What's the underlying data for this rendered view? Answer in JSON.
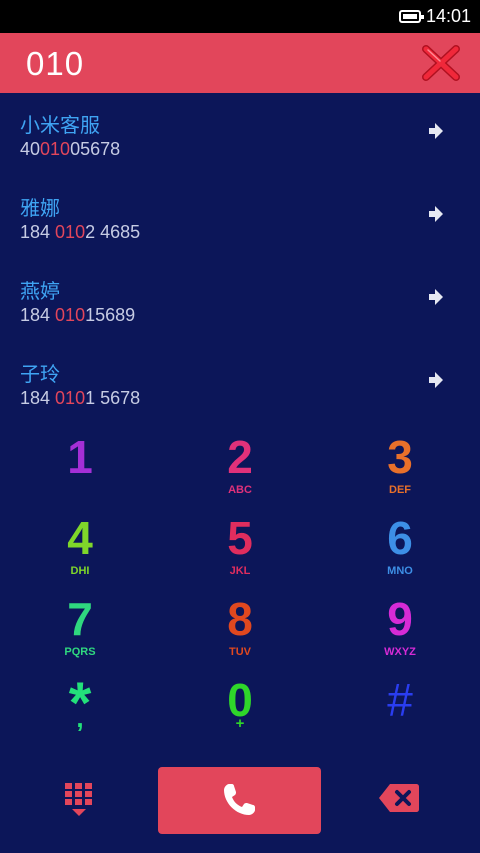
{
  "status_bar": {
    "time": "14:01"
  },
  "search": {
    "query": "010"
  },
  "results": [
    {
      "name": "小米客服",
      "number_pre": "40",
      "number_match": "010",
      "number_post": "05678"
    },
    {
      "name": "雅娜",
      "number_pre": "184 ",
      "number_match": "010",
      "number_post": "2 4685"
    },
    {
      "name": "燕婷",
      "number_pre": "184 ",
      "number_match": "010",
      "number_post": "15689"
    },
    {
      "name": "子玲",
      "number_pre": "184 ",
      "number_match": "010",
      "number_post": "1 5678"
    }
  ],
  "keypad": [
    {
      "digit": "1",
      "letters": "",
      "color": "#a42fd6"
    },
    {
      "digit": "2",
      "letters": "ABC",
      "color": "#e0317a"
    },
    {
      "digit": "3",
      "letters": "DEF",
      "color": "#e8702a"
    },
    {
      "digit": "4",
      "letters": "DHI",
      "color": "#7fd62a"
    },
    {
      "digit": "5",
      "letters": "JKL",
      "color": "#e02d5e"
    },
    {
      "digit": "6",
      "letters": "MNO",
      "color": "#3d8fe6"
    },
    {
      "digit": "7",
      "letters": "PQRS",
      "color": "#2fd87f"
    },
    {
      "digit": "8",
      "letters": "TUV",
      "color": "#e0481f"
    },
    {
      "digit": "9",
      "letters": "WXYZ",
      "color": "#d62bd6"
    },
    {
      "digit": "*",
      "letters": ",",
      "color": "#23e07a"
    },
    {
      "digit": "0",
      "letters": "+",
      "color": "#2fd62a"
    },
    {
      "digit": "#",
      "letters": "",
      "color": "#2a3df0"
    }
  ],
  "colors": {
    "accent": "#e2465b",
    "background": "#0c1659",
    "name": "#3fa4f3",
    "number": "#c7cce4"
  }
}
